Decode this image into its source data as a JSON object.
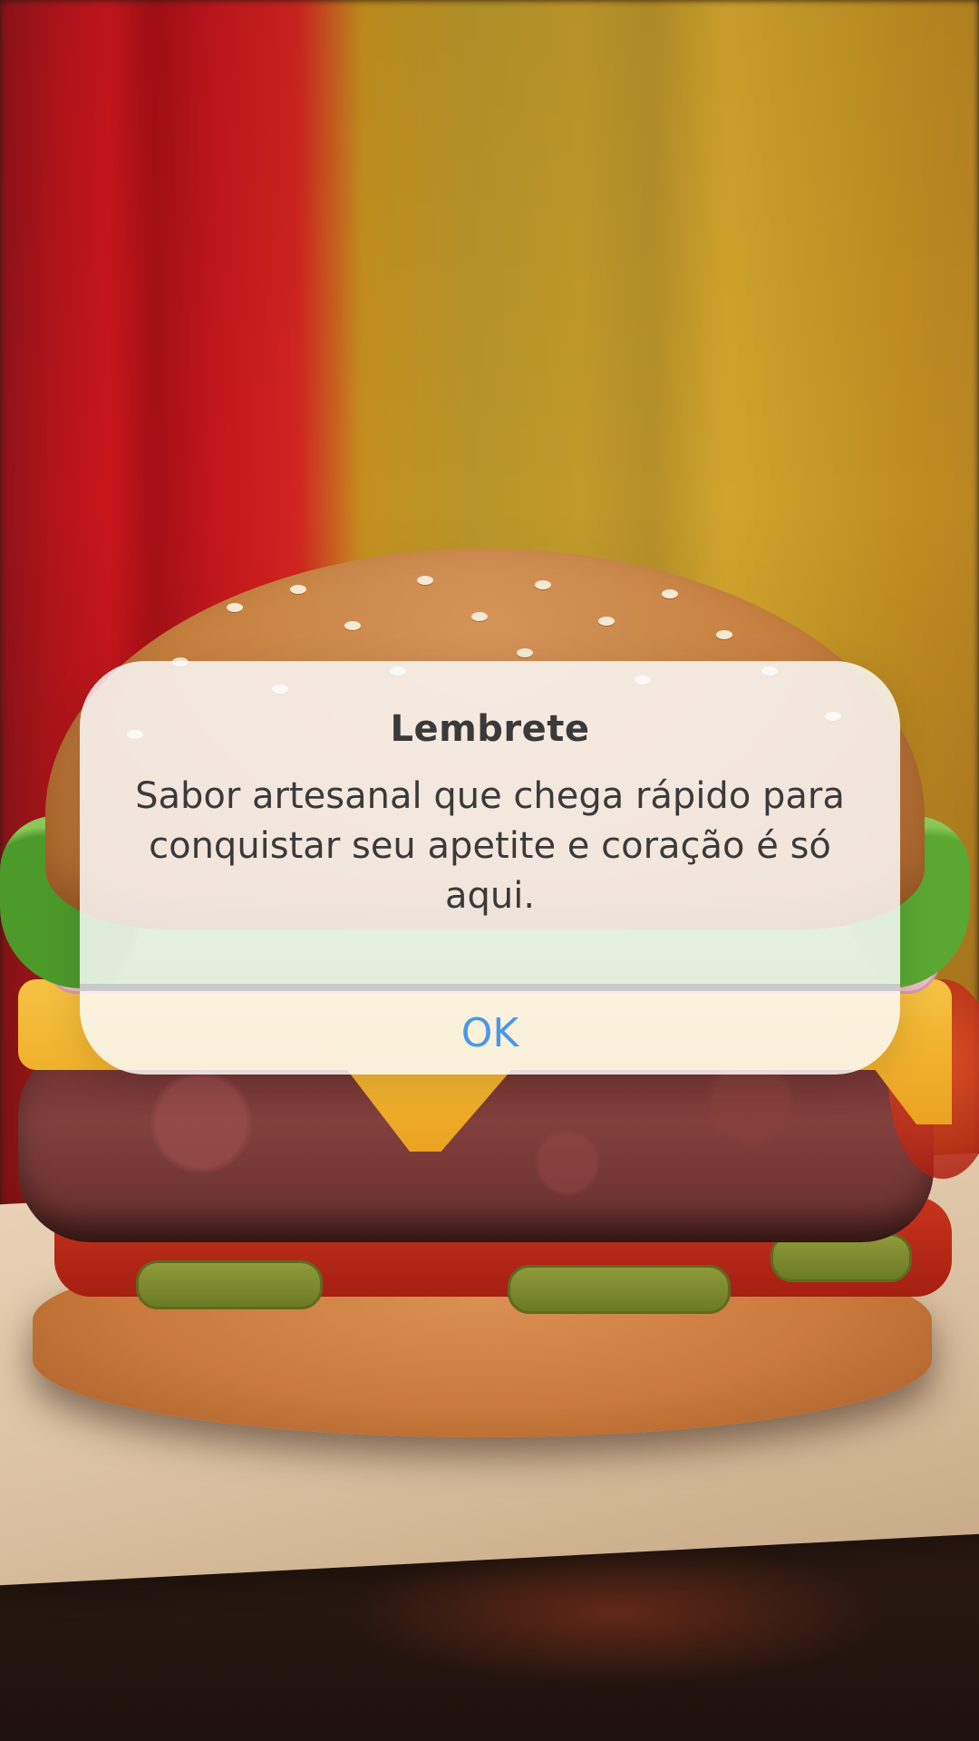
{
  "dialog": {
    "title": "Lembrete",
    "message": "Sabor artesanal que chega rápido para conquistar seu apetite e coração é só aqui.",
    "ok_label": "OK"
  },
  "colors": {
    "dialog_background": "#fcfcfc",
    "text": "#3a3a3a",
    "ok_accent": "#4a97e8"
  }
}
